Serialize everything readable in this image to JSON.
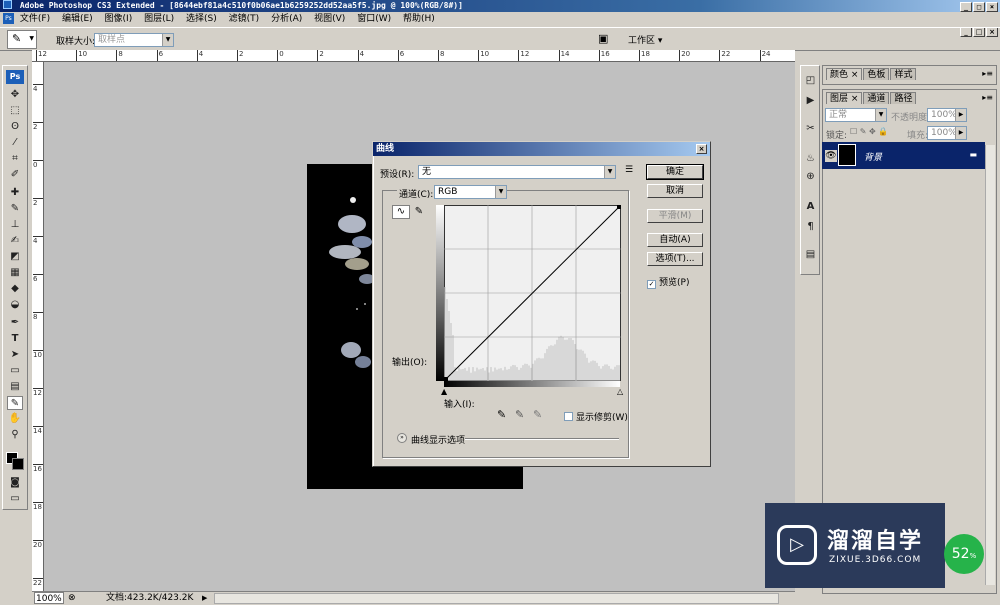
{
  "window": {
    "title": "Adobe Photoshop CS3 Extended - [8644ebf81a4c510f0b06ae1b6259252dd52aa5f5.jpg @ 100%(RGB/8#)]"
  },
  "menu": [
    "文件(F)",
    "编辑(E)",
    "图像(I)",
    "图层(L)",
    "选择(S)",
    "滤镜(T)",
    "分析(A)",
    "视图(V)",
    "窗口(W)",
    "帮助(H)"
  ],
  "options_bar": {
    "sample_size_label": "取样大小:",
    "sample_size_value": "取样点",
    "workspace_label": "工作区 ▾"
  },
  "ruler_h": [
    "12",
    "10",
    "8",
    "6",
    "4",
    "2",
    "0",
    "2",
    "4",
    "6",
    "8",
    "10",
    "12",
    "14",
    "16",
    "18",
    "20",
    "22",
    "24"
  ],
  "ruler_v": [
    "4",
    "2",
    "0",
    "2",
    "4",
    "6",
    "8",
    "10",
    "12",
    "14",
    "16",
    "18",
    "20",
    "22"
  ],
  "status": {
    "zoom": "100%",
    "doc": "文档:423.2K/423.2K"
  },
  "dialog": {
    "title": "曲线",
    "preset_label": "预设(R):",
    "preset_value": "无",
    "channel_label": "通道(C):",
    "channel_value": "RGB",
    "output_label": "输出(O):",
    "input_label": "输入(I):",
    "show_clipping": "显示修剪(W)",
    "display_options": "曲线显示选项",
    "buttons": {
      "ok": "确定",
      "cancel": "取消",
      "smooth": "平滑(M)",
      "auto": "自动(A)",
      "options": "选项(T)...",
      "preview": "预览(P)"
    },
    "preview_checked": true
  },
  "panels": {
    "top_tabs": [
      "颜色",
      "色板",
      "样式"
    ],
    "layer_tabs": [
      "图层",
      "通道",
      "路径"
    ],
    "blend_mode": "正常",
    "opacity_label": "不透明度:",
    "opacity_value": "100%",
    "lock_label": "锁定:",
    "fill_label": "填充:",
    "fill_value": "100%",
    "layer_name": "背景"
  },
  "watermark": {
    "brand": "溜溜自学",
    "url": "ZIXUE.3D66.COM",
    "badge": "52"
  },
  "colors": {
    "title_bar": "#0a246a",
    "selected_layer": "#0a246a",
    "canvas_bg": "#c0c0c0",
    "badge": "#26b34a"
  }
}
